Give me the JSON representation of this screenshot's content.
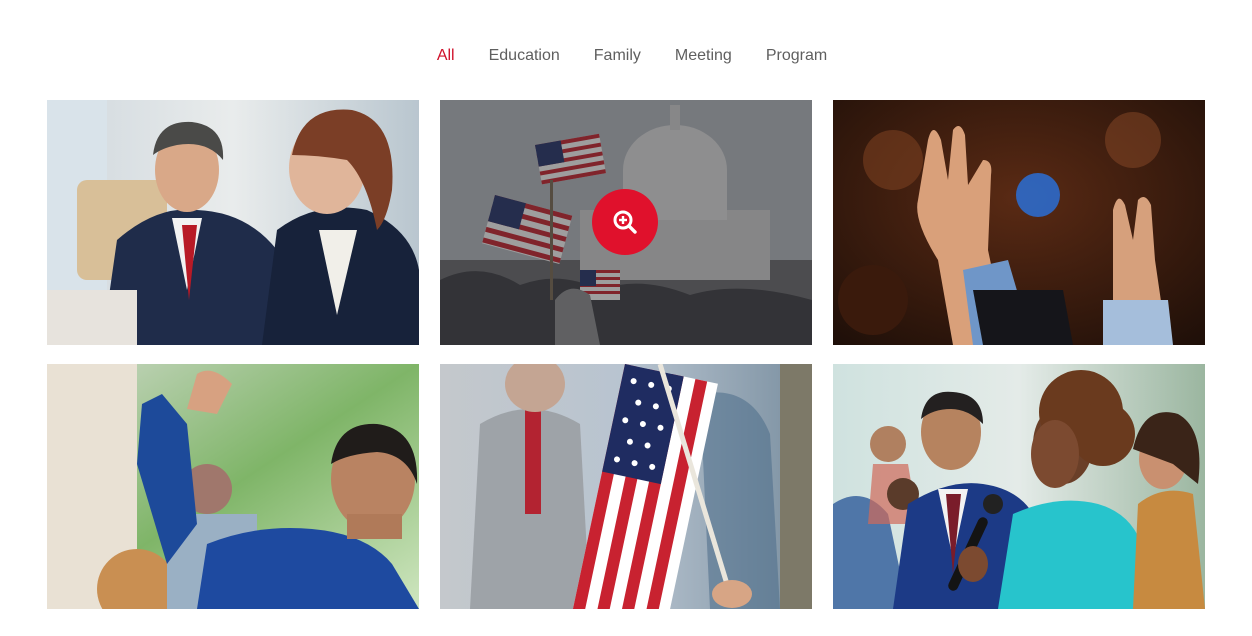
{
  "filters": {
    "items": [
      {
        "label": "All",
        "active": true
      },
      {
        "label": "Education",
        "active": false
      },
      {
        "label": "Family",
        "active": false
      },
      {
        "label": "Meeting",
        "active": false
      },
      {
        "label": "Program",
        "active": false
      }
    ]
  },
  "gallery": {
    "hovered_index": 1,
    "zoom_icon": "zoom-in-icon",
    "items": [
      {
        "image": "business-meeting-photo"
      },
      {
        "image": "capitol-flags-photo"
      },
      {
        "image": "raised-hands-photo"
      },
      {
        "image": "man-raising-hand-photo"
      },
      {
        "image": "american-flag-photo"
      },
      {
        "image": "woman-with-microphone-photo"
      }
    ]
  },
  "colors": {
    "accent": "#d0112b",
    "filter_text": "#5f5f5f",
    "zoom_button": "#e0112c"
  }
}
